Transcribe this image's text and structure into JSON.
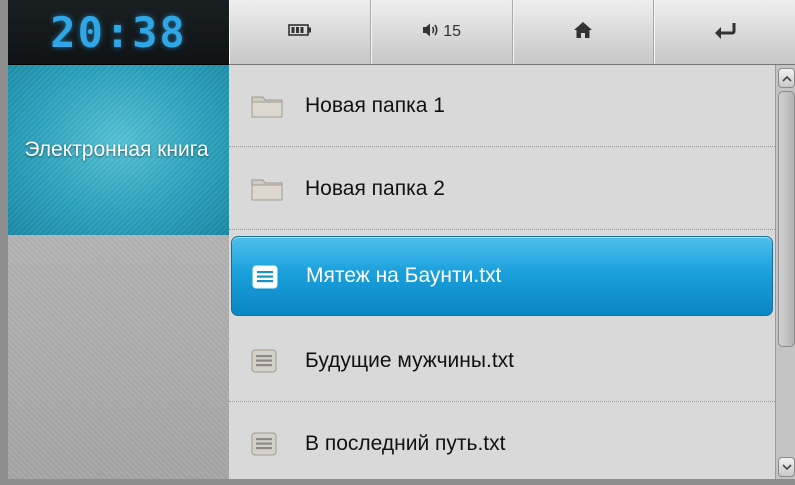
{
  "clock": {
    "time": "20:38"
  },
  "app": {
    "title": "Электронная книга"
  },
  "topbar": {
    "battery_icon": "battery-icon",
    "volume_icon": "volume-icon",
    "volume_level": "15",
    "home_icon": "home-icon",
    "back_icon": "back-arrow-icon"
  },
  "files": {
    "items": [
      {
        "name": "Новая папка 1",
        "type": "folder",
        "icon": "folder-icon",
        "selected": false
      },
      {
        "name": "Новая папка 2",
        "type": "folder",
        "icon": "folder-icon",
        "selected": false
      },
      {
        "name": "Мятеж на Баунти.txt",
        "type": "text-file",
        "icon": "document-icon",
        "selected": true
      },
      {
        "name": "Будущие мужчины.txt",
        "type": "text-file",
        "icon": "document-icon",
        "selected": false
      },
      {
        "name": "В последний путь.txt",
        "type": "text-file",
        "icon": "document-icon",
        "selected": false
      }
    ]
  },
  "colors": {
    "accent": "#1aa0dc",
    "clock_digits": "#2fa6e6",
    "tile": "#2ba3bd"
  }
}
